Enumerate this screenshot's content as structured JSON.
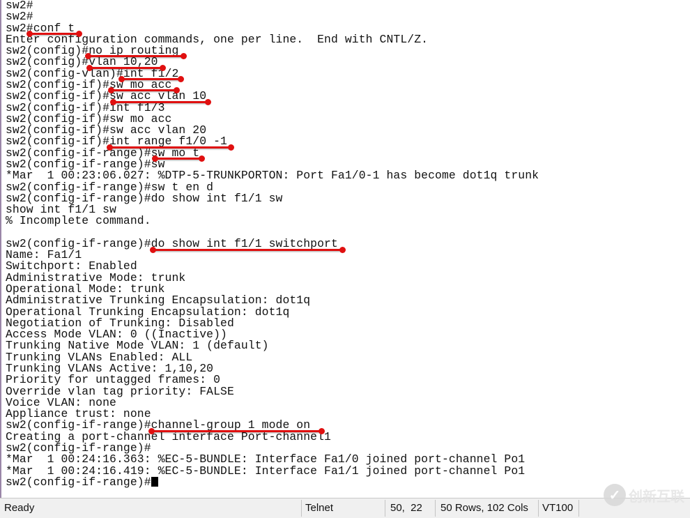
{
  "terminal": {
    "lines": [
      "sw2#",
      "sw2#",
      "sw2#conf t",
      "Enter configuration commands, one per line.  End with CNTL/Z.",
      "sw2(config)#no ip routing",
      "sw2(config)#vlan 10,20",
      "sw2(config-vlan)#int f1/2",
      "sw2(config-if)#sw mo acc",
      "sw2(config-if)#sw acc vlan 10",
      "sw2(config-if)#int f1/3",
      "sw2(config-if)#sw mo acc",
      "sw2(config-if)#sw acc vlan 20",
      "sw2(config-if)#int range f1/0 -1",
      "sw2(config-if-range)#sw mo t",
      "sw2(config-if-range)#sw",
      "*Mar  1 00:23:06.027: %DTP-5-TRUNKPORTON: Port Fa1/0-1 has become dot1q trunk",
      "sw2(config-if-range)#sw t en d",
      "sw2(config-if-range)#do show int f1/1 sw",
      "show int f1/1 sw",
      "% Incomplete command.",
      "",
      "sw2(config-if-range)#do show int f1/1 switchport",
      "Name: Fa1/1",
      "Switchport: Enabled",
      "Administrative Mode: trunk",
      "Operational Mode: trunk",
      "Administrative Trunking Encapsulation: dot1q",
      "Operational Trunking Encapsulation: dot1q",
      "Negotiation of Trunking: Disabled",
      "Access Mode VLAN: 0 ((Inactive))",
      "Trunking Native Mode VLAN: 1 (default)",
      "Trunking VLANs Enabled: ALL",
      "Trunking VLANs Active: 1,10,20",
      "Priority for untagged frames: 0",
      "Override vlan tag priority: FALSE",
      "Voice VLAN: none",
      "Appliance trust: none",
      "sw2(config-if-range)#channel-group 1 mode on",
      "Creating a port-channel interface Port-channel1",
      "sw2(config-if-range)#",
      "*Mar  1 00:24:16.363: %EC-5-BUNDLE: Interface Fa1/0 joined port-channel Po1",
      "*Mar  1 00:24:16.419: %EC-5-BUNDLE: Interface Fa1/1 joined port-channel Po1",
      "sw2(config-if-range)#"
    ],
    "annotation_color": "#e01010"
  },
  "status_bar": {
    "state": "Ready",
    "protocol": "Telnet",
    "cursor_position": "50,  22",
    "size": "50 Rows, 102 Cols",
    "emulation": "VT100"
  },
  "watermark": {
    "text": "创新互联",
    "icon": "logo-icon"
  }
}
